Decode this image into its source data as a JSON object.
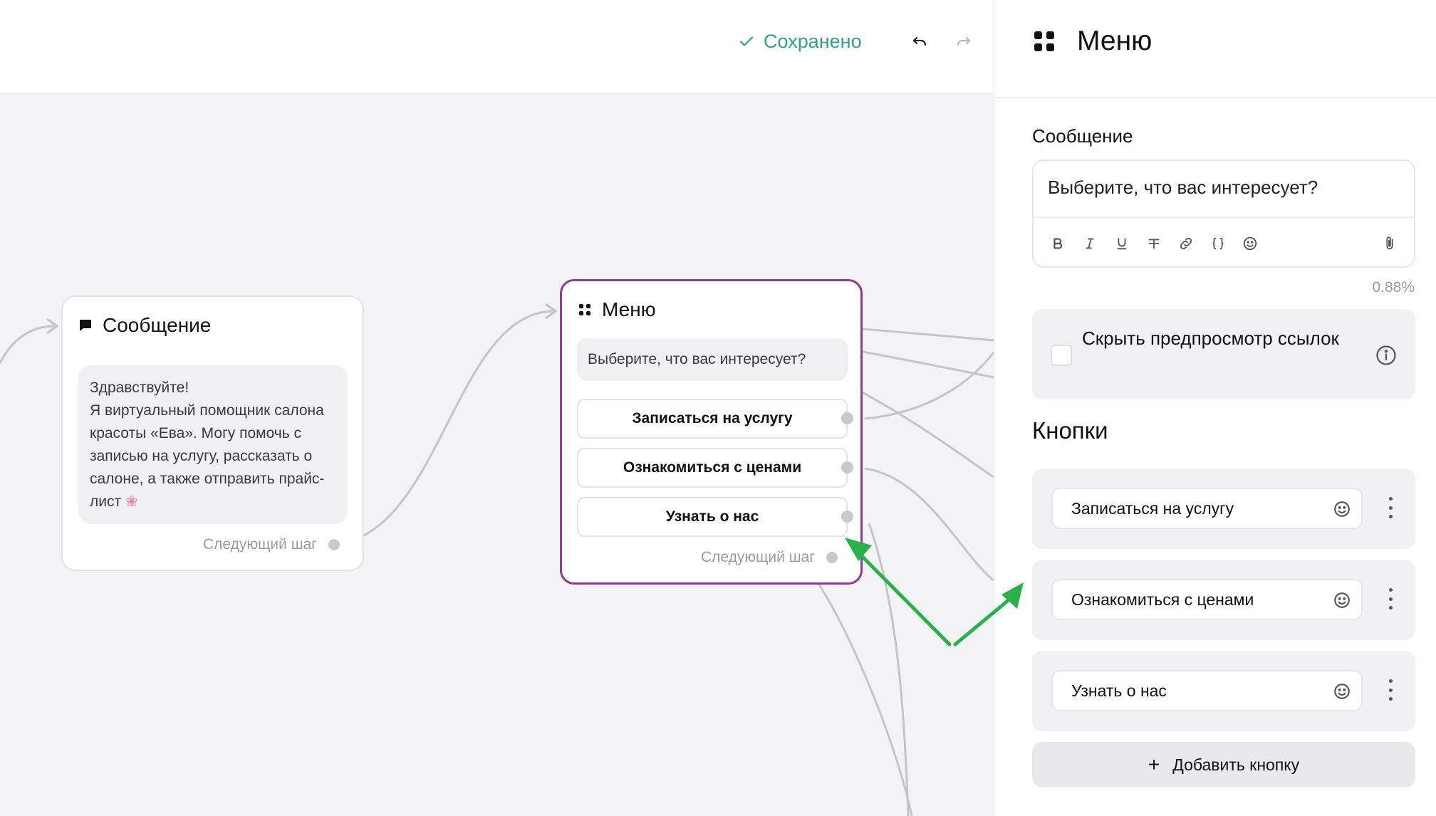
{
  "topbar": {
    "saved_label": "Сохранено"
  },
  "nodes": {
    "message": {
      "title": "Сообщение",
      "text": "Здравствуйте!\nЯ виртуальный помощник салона красоты «Ева». Могу помочь с записью на услугу, рассказать о салоне, а также отправить прайс-лист",
      "next_step": "Следующий шаг"
    },
    "menu": {
      "title": "Меню",
      "message": "Выберите, что вас интересует?",
      "buttons": [
        "Записаться на услугу",
        "Ознакомиться с ценами",
        "Узнать о нас"
      ],
      "next_step": "Следующий шаг"
    }
  },
  "panel": {
    "title": "Меню",
    "message_label": "Сообщение",
    "message_value": "Выберите, что вас интересует?",
    "char_count": "0.88%",
    "hide_preview_label": "Скрыть предпросмотр ссылок",
    "hide_preview_checked": false,
    "buttons_label": "Кнопки",
    "buttons": [
      "Записаться на услугу",
      "Ознакомиться с ценами",
      "Узнать о нас"
    ],
    "add_button_label": "Добавить кнопку"
  },
  "colors": {
    "accent_saved": "#2aa58a",
    "selected_node_border": "#8e3c8f",
    "annotation_arrow": "#27b34a"
  }
}
